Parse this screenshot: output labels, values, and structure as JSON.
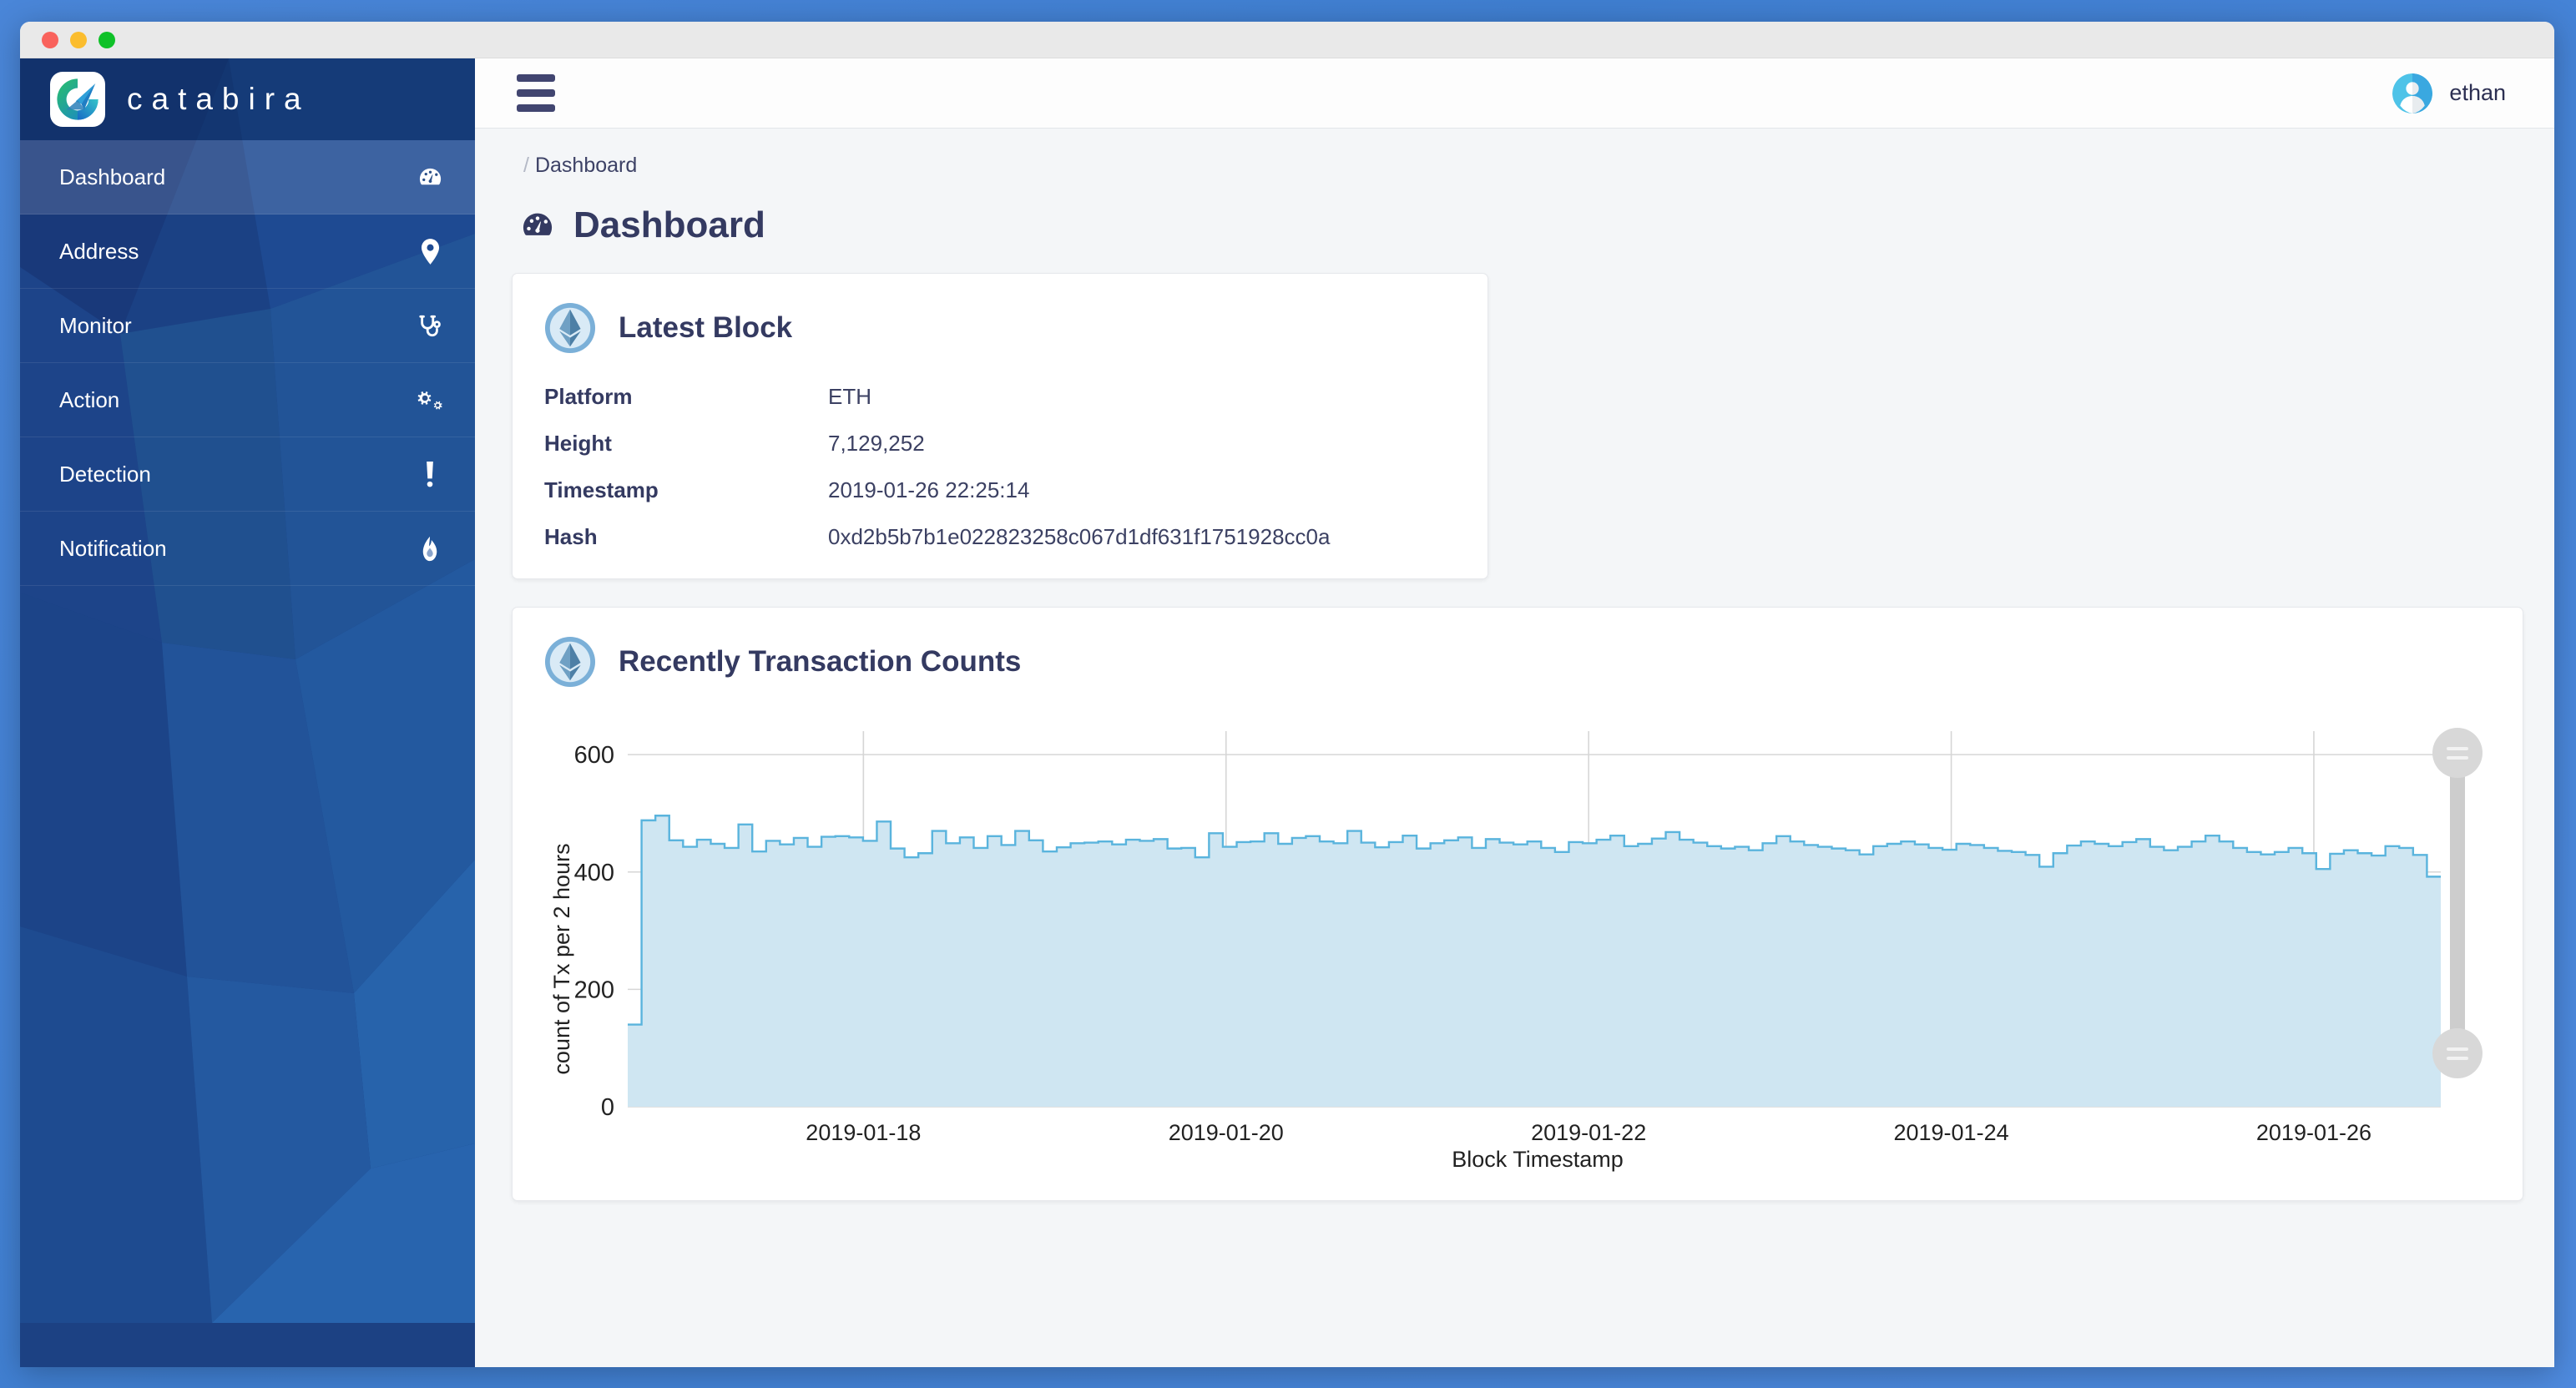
{
  "window": {
    "traffic_lights": [
      {
        "name": "close",
        "color": "#f9625c"
      },
      {
        "name": "minimize",
        "color": "#fbbd2e"
      },
      {
        "name": "maximize",
        "color": "#0fc128"
      }
    ]
  },
  "sidebar": {
    "brand": "catabira",
    "items": [
      {
        "label": "Dashboard",
        "icon": "tachometer-icon",
        "active": true
      },
      {
        "label": "Address",
        "icon": "map-marker-icon",
        "active": false
      },
      {
        "label": "Monitor",
        "icon": "stethoscope-icon",
        "active": false
      },
      {
        "label": "Action",
        "icon": "cogs-icon",
        "active": false
      },
      {
        "label": "Detection",
        "icon": "exclamation-icon",
        "active": false
      },
      {
        "label": "Notification",
        "icon": "fire-icon",
        "active": false
      }
    ]
  },
  "topbar": {
    "menu_icon": "hamburger-icon",
    "username": "ethan",
    "avatar_icon": "user-avatar-icon"
  },
  "breadcrumb": {
    "separator": "/",
    "current": "Dashboard"
  },
  "page": {
    "title": "Dashboard",
    "title_icon": "tachometer-icon"
  },
  "latest_block": {
    "title": "Latest Block",
    "platform_icon": "ethereum-icon",
    "rows": [
      {
        "label": "Platform",
        "value": "ETH"
      },
      {
        "label": "Height",
        "value": "7,129,252"
      },
      {
        "label": "Timestamp",
        "value": "2019-01-26 22:25:14"
      },
      {
        "label": "Hash",
        "value": "0xd2b5b7b1e022823258c067d1df631f1751928cc0a"
      }
    ]
  },
  "tx_chart_card": {
    "title": "Recently Transaction Counts",
    "platform_icon": "ethereum-icon",
    "slider": {
      "name": "vertical-range-slider",
      "top_handle": "slider-handle-top",
      "bottom_handle": "slider-handle-bottom"
    }
  },
  "colors": {
    "sidebar_base": "#1c4183",
    "sidebar_active": "#38598f",
    "brand_navy": "#343a61",
    "chart_line": "#5ab4dd",
    "chart_fill": "#cfe6f2",
    "accent_blue": "#4a86d8"
  },
  "chart_data": {
    "type": "area",
    "title": "Recently Transaction Counts",
    "xlabel": "Block Timestamp",
    "ylabel": "count of Tx per 2 hours",
    "step": "post",
    "grid": true,
    "legend": null,
    "ylim": [
      0,
      640
    ],
    "yticks": [
      0,
      200,
      400,
      600
    ],
    "xticks": [
      "2019-01-18",
      "2019-01-20",
      "2019-01-22",
      "2019-01-24",
      "2019-01-26"
    ],
    "xtick_positions": [
      0.13,
      0.33,
      0.53,
      0.73,
      0.93
    ],
    "x_start": "2019-01-17 06:00",
    "x_end": "2019-01-26 22:00",
    "bin_hours": 2,
    "values": [
      140,
      488,
      496,
      454,
      443,
      455,
      448,
      441,
      481,
      435,
      453,
      447,
      458,
      443,
      460,
      461,
      459,
      453,
      486,
      440,
      425,
      432,
      470,
      449,
      459,
      441,
      461,
      446,
      470,
      454,
      435,
      442,
      449,
      450,
      452,
      447,
      455,
      453,
      456,
      440,
      441,
      425,
      466,
      443,
      451,
      452,
      466,
      448,
      458,
      461,
      452,
      449,
      470,
      450,
      442,
      451,
      462,
      440,
      449,
      454,
      459,
      441,
      456,
      450,
      447,
      452,
      441,
      434,
      451,
      449,
      455,
      462,
      444,
      448,
      457,
      468,
      455,
      450,
      444,
      440,
      443,
      437,
      449,
      461,
      452,
      446,
      443,
      440,
      437,
      430,
      444,
      448,
      452,
      447,
      441,
      438,
      448,
      446,
      441,
      436,
      434,
      429,
      409,
      432,
      445,
      452,
      448,
      444,
      451,
      456,
      443,
      437,
      443,
      452,
      462,
      452,
      441,
      434,
      430,
      434,
      441,
      432,
      405,
      431,
      437,
      432,
      428,
      444,
      441,
      429,
      392
    ]
  }
}
